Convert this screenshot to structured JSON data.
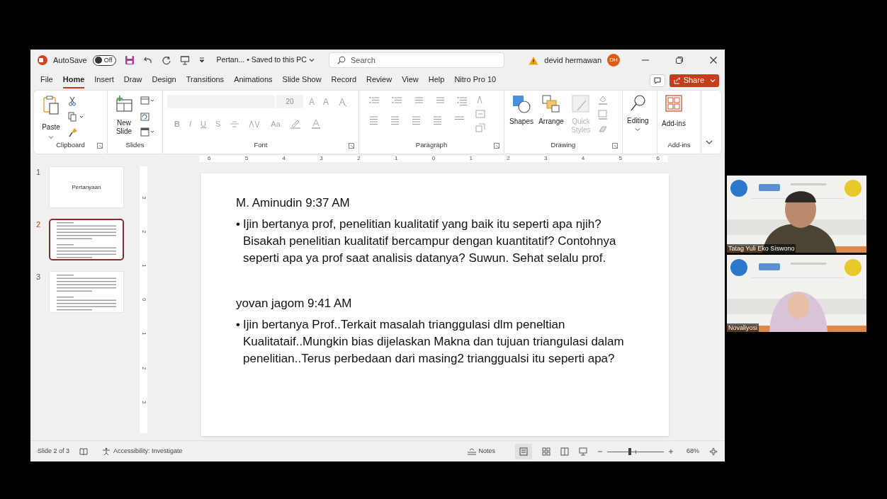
{
  "title_bar": {
    "autosave_label": "AutoSave",
    "autosave_toggle": {
      "label": "Off",
      "on": false
    },
    "file_name": "Pertan... • Saved to this PC",
    "search_placeholder": "Search",
    "user_name": "devid hermawan",
    "avatar": "DH"
  },
  "menu_tabs": [
    {
      "label": "File",
      "selected": false
    },
    {
      "label": "Home",
      "selected": true
    },
    {
      "label": "Insert",
      "selected": false
    },
    {
      "label": "Draw",
      "selected": false
    },
    {
      "label": "Design",
      "selected": false
    },
    {
      "label": "Transitions",
      "selected": false
    },
    {
      "label": "Animations",
      "selected": false
    },
    {
      "label": "Slide Show",
      "selected": false
    },
    {
      "label": "Record",
      "selected": false
    },
    {
      "label": "Review",
      "selected": false
    },
    {
      "label": "View",
      "selected": false
    },
    {
      "label": "Help",
      "selected": false
    },
    {
      "label": "Nitro Pro 10",
      "selected": false
    }
  ],
  "share_button": "Share",
  "ribbon": {
    "clipboard": {
      "label": "Clipboard",
      "paste": "Paste"
    },
    "slides": {
      "label": "Slides",
      "new_slide": "New Slide"
    },
    "font": {
      "label": "Font",
      "font_size": "20",
      "size_buttons": [
        "A",
        "A"
      ],
      "format_buttons": [
        "B",
        "I",
        "U",
        "S"
      ],
      "case_button": "Aa"
    },
    "paragraph": {
      "label": "Paragraph"
    },
    "drawing": {
      "label": "Drawing",
      "buttons": [
        {
          "label": "Shapes",
          "disabled": false
        },
        {
          "label": "Arrange",
          "disabled": false
        },
        {
          "label": "Quick Styles",
          "disabled": true
        }
      ]
    },
    "editing": {
      "label": "Editing"
    },
    "addins": {
      "label": "Add-ins",
      "button": "Add-ins"
    }
  },
  "horizontal_ruler": [
    "6",
    "5",
    "4",
    "3",
    "2",
    "1",
    "0",
    "1",
    "2",
    "3",
    "4",
    "5",
    "6"
  ],
  "vertical_ruler": [
    "3",
    "2",
    "1",
    "0",
    "1",
    "2",
    "3"
  ],
  "slides": [
    {
      "number": "1",
      "selected": false,
      "title": "Pertanyaan"
    },
    {
      "number": "2",
      "selected": true
    },
    {
      "number": "3",
      "selected": false
    }
  ],
  "slide": {
    "entries": [
      {
        "author": "M. Aminudin 9:37 AM",
        "bullet": "•",
        "text": "Ijin bertanya prof, penelitian kualitatif yang baik itu seperti apa njih? Bisakah penelitian kualitatif bercampur dengan kuantitatif? Contohnya seperti apa ya prof saat analisis datanya? Suwun. Sehat selalu prof."
      },
      {
        "author": "yovan jagom 9:41 AM",
        "bullet": "•",
        "text": "Ijin bertanya Prof..Terkait masalah trianggulasi dlm peneltian Kualitataif..Mungkin bias dijelaskan Makna dan tujuan triangulasi dalam penelitian..Terus perbedaan dari masing2 trianggualsi itu seperti apa?"
      }
    ]
  },
  "status_bar": {
    "slide_count": "Slide 2 of 3",
    "accessibility": "Accessibility: Investigate",
    "notes": "Notes",
    "zoom_slider": {
      "level": 0.4
    },
    "zoom": "68%"
  },
  "video_tiles": [
    {
      "name": "Tatag Yuli Eko Siswono",
      "kind": "picture"
    },
    {
      "name": "Novaliyosi",
      "kind": "picture"
    }
  ]
}
